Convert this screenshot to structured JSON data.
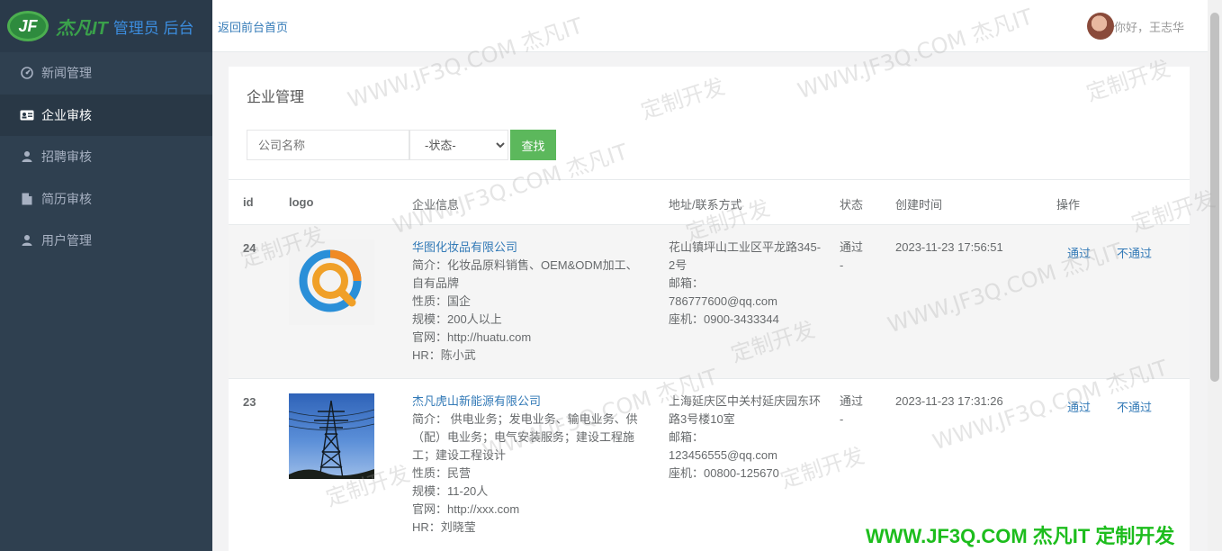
{
  "brand": {
    "logo_text": "JF",
    "name": "杰凡IT",
    "sub": "管理员 后台"
  },
  "nav": [
    {
      "label": "新闻管理",
      "icon": "dashboard-icon",
      "active": false
    },
    {
      "label": "企业审核",
      "icon": "id-card-icon",
      "active": true
    },
    {
      "label": "招聘审核",
      "icon": "user-icon",
      "active": false
    },
    {
      "label": "简历审核",
      "icon": "file-icon",
      "active": false
    },
    {
      "label": "用户管理",
      "icon": "user-icon",
      "active": false
    }
  ],
  "topbar": {
    "back_link": "返回前台首页",
    "greeting": "你好，王志华"
  },
  "panel": {
    "title": "企业管理",
    "search_placeholder": "公司名称",
    "status_selected": "-状态-",
    "search_button": "查找"
  },
  "table": {
    "headers": {
      "id": "id",
      "logo": "logo",
      "info": "企业信息",
      "addr": "地址/联系方式",
      "status": "状态",
      "time": "创建时间",
      "op": "操作"
    },
    "rows": [
      {
        "id": "24",
        "company": "华图化妆品有限公司",
        "intro": "简介：化妆品原料销售、OEM&ODM加工、自有品牌",
        "nature": "性质：国企",
        "scale": "规模：200人以上",
        "site": "官网：http://huatu.com",
        "hr": "HR：陈小武",
        "address": "花山镇坪山工业区平龙路345-2号",
        "email_label": "邮箱：",
        "email": "786777600@qq.com",
        "phone": "座机：0900-3433344",
        "status": "通过",
        "status_sub": "-",
        "time": "2023-11-23 17:56:51",
        "op_pass": "通过",
        "op_reject": "不通过"
      },
      {
        "id": "23",
        "company": "杰凡虎山新能源有限公司",
        "intro": "简介： 供电业务；发电业务、输电业务、供（配）电业务；电气安装服务；建设工程施工；建设工程设计",
        "nature": "性质：民营",
        "scale": "规模：11-20人",
        "site": "官网：http://xxx.com",
        "hr": "HR：刘晓莹",
        "address": "上海延庆区中关村延庆园东环路3号楼10室",
        "email_label": "邮箱：",
        "email": "123456555@qq.com",
        "phone": "座机：00800-125670",
        "status": "通过",
        "status_sub": "-",
        "time": "2023-11-23 17:31:26",
        "op_pass": "通过",
        "op_reject": "不通过"
      }
    ]
  },
  "watermark": {
    "url": "WWW.JF3Q.COM 杰凡IT",
    "slogan": "定制开发",
    "banner": "WWW.JF3Q.COM 杰凡IT  定制开发"
  },
  "colors": {
    "sidebar": "#2f4050",
    "link": "#337ab7",
    "button": "#5cb85c",
    "banner": "#1dbd1d"
  }
}
